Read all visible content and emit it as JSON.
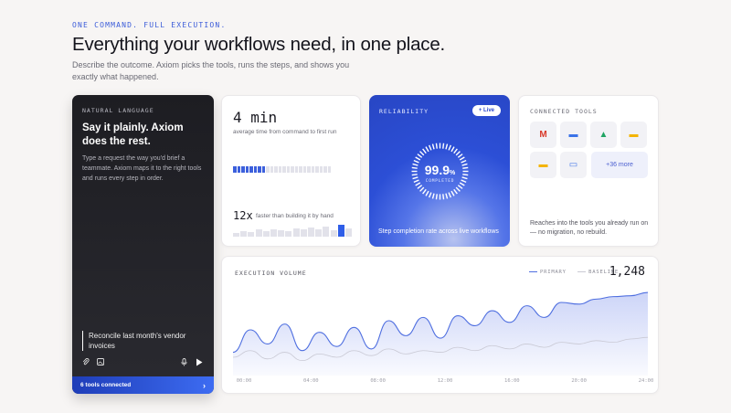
{
  "header": {
    "eyebrow": "ONE COMMAND. FULL EXECUTION.",
    "title": "Everything your workflows need, in one place.",
    "subtitle": "Describe the outcome. Axiom picks the tools, runs the steps, and shows you exactly what happened."
  },
  "natural_language": {
    "label": "NATURAL LANGUAGE",
    "title": "Say it plainly. Axiom does the rest.",
    "description": "Type a request the way you'd brief a teammate. Axiom maps it to the right tools and runs every step in order.",
    "prompt": "Reconcile last month's vendor invoices",
    "footer": "6 tools connected",
    "footer_arrow": "›",
    "icons": [
      "paperclip-icon",
      "image-icon",
      "microphone-icon",
      "play-icon"
    ]
  },
  "speed": {
    "value": "4 min",
    "caption": "average time from command to first run",
    "progress_filled": 8,
    "progress_total": 24,
    "multiplier": "12x",
    "multiplier_caption": "faster than building it by hand",
    "bar_levels": [
      0.3,
      0.45,
      0.35,
      0.55,
      0.4,
      0.6,
      0.5,
      0.45,
      0.65,
      0.55,
      0.7,
      0.6,
      0.8,
      0.5,
      0.9,
      0.65
    ],
    "highlight_index": 14
  },
  "reliability": {
    "label": "RELIABILITY",
    "badge": "+ Live",
    "value": "99.9",
    "unit": "%",
    "sublabel": "COMPLETED",
    "footer": "Step completion rate across live workflows",
    "completion": 0.999
  },
  "connected_tools": {
    "label": "CONNECTED TOOLS",
    "tools": [
      {
        "icon": "gmail-icon",
        "glyph": "M",
        "color": "#d93a2b"
      },
      {
        "icon": "docs-icon",
        "glyph": "▬",
        "color": "#3b73e8"
      },
      {
        "icon": "drive-icon",
        "glyph": "▲",
        "color": "#1fa463"
      },
      {
        "icon": "slides-icon",
        "glyph": "▬",
        "color": "#f4b400"
      },
      {
        "icon": "sheets-icon",
        "glyph": "▬",
        "color": "#f4b400"
      },
      {
        "icon": "calendar-icon",
        "glyph": "▭",
        "color": "#4a7ae8"
      }
    ],
    "more": "+36 more",
    "footer": "Reaches into the tools you already run on — no migration, no rebuild."
  },
  "execution_volume": {
    "label": "EXECUTION VOLUME",
    "legend_primary": "PRIMARY",
    "legend_baseline": "BASELINE",
    "total": "1,248",
    "x_labels": [
      "00:00",
      "04:00",
      "08:00",
      "12:00",
      "16:00",
      "20:00",
      "24:00"
    ],
    "colors": {
      "primary": "#4f6fe0",
      "baseline": "#c9c9d4"
    }
  },
  "chart_data": {
    "type": "area",
    "x": [
      "00:00",
      "04:00",
      "08:00",
      "12:00",
      "16:00",
      "20:00",
      "24:00"
    ],
    "series": [
      {
        "name": "PRIMARY",
        "values": [
          28,
          55,
          38,
          62,
          30,
          52,
          35,
          58,
          32,
          66,
          48,
          70,
          45,
          72,
          60,
          78,
          64,
          84,
          70,
          88,
          86,
          92,
          95,
          96,
          100
        ]
      },
      {
        "name": "BASELINE",
        "values": [
          22,
          30,
          20,
          28,
          18,
          26,
          22,
          30,
          24,
          32,
          26,
          30,
          28,
          34,
          30,
          36,
          32,
          38,
          34,
          40,
          38,
          42,
          40,
          44,
          46
        ]
      }
    ],
    "ylim": [
      0,
      110
    ]
  }
}
